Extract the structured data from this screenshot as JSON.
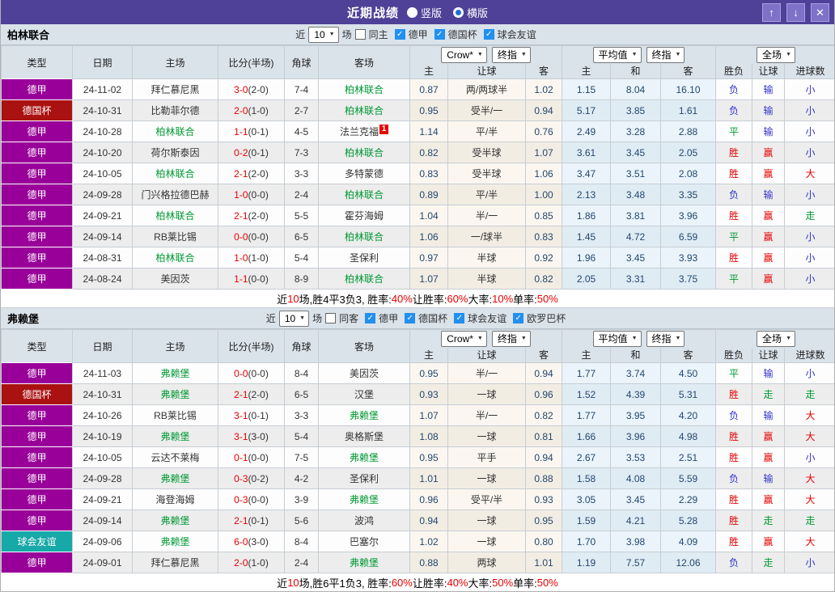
{
  "titlebar": {
    "title": "近期战绩",
    "radios": [
      {
        "label": "竖版",
        "selected": false
      },
      {
        "label": "横版",
        "selected": true
      }
    ],
    "buttons": {
      "up": "↑",
      "down": "↓",
      "close": "✕"
    }
  },
  "table_header": {
    "left_cols": [
      "类型",
      "日期",
      "主场",
      "比分(半场)",
      "角球",
      "客场"
    ],
    "dropdowns": {
      "crow": "Crow*",
      "final1": "终指",
      "avg": "平均值",
      "final2": "终指",
      "fulltime": "全场"
    },
    "sub_cols": [
      "主",
      "让球",
      "客",
      "主",
      "和",
      "客",
      "胜负",
      "让球",
      "进球数"
    ]
  },
  "type_colors": {
    "德甲": "#990099",
    "德国杯": "#aa1111",
    "球会友谊": "#17a8a8"
  },
  "result_colors": {
    "胜": "#e60000",
    "平": "#009933",
    "负": "#3333cc",
    "赢": "#e60000",
    "走": "#009933",
    "输": "#3333cc",
    "大": "#e60000",
    "小": "#3333cc"
  },
  "sections": [
    {
      "team": "柏林联合",
      "filter": {
        "near": "近",
        "count": "10",
        "games": "场",
        "same_checked": false,
        "same_label": "同主",
        "leagues": [
          {
            "label": "德甲",
            "checked": true
          },
          {
            "label": "德国杯",
            "checked": true
          },
          {
            "label": "球会友谊",
            "checked": true
          }
        ]
      },
      "rows": [
        {
          "type": "德甲",
          "date": "24-11-02",
          "home": "拜仁慕尼黑",
          "hs": false,
          "ft": "3-0",
          "half": "(2-0)",
          "corner": "7-4",
          "away": "柏林联合",
          "as": true,
          "badge": "",
          "ch": "0.87",
          "hc": "两/两球半",
          "ca": "1.02",
          "ah": "1.15",
          "ad": "8.04",
          "aa": "16.10",
          "r1": "负",
          "r2": "输",
          "r3": "小"
        },
        {
          "type": "德国杯",
          "date": "24-10-31",
          "home": "比勒菲尔德",
          "hs": false,
          "ft": "2-0",
          "half": "(1-0)",
          "corner": "2-7",
          "away": "柏林联合",
          "as": true,
          "badge": "",
          "ch": "0.95",
          "hc": "受半/一",
          "ca": "0.94",
          "ah": "5.17",
          "ad": "3.85",
          "aa": "1.61",
          "r1": "负",
          "r2": "输",
          "r3": "小"
        },
        {
          "type": "德甲",
          "date": "24-10-28",
          "home": "柏林联合",
          "hs": true,
          "ft": "1-1",
          "half": "(0-1)",
          "corner": "4-5",
          "away": "法兰克福",
          "as": false,
          "badge": "1",
          "ch": "1.14",
          "hc": "平/半",
          "ca": "0.76",
          "ah": "2.49",
          "ad": "3.28",
          "aa": "2.88",
          "r1": "平",
          "r2": "输",
          "r3": "小"
        },
        {
          "type": "德甲",
          "date": "24-10-20",
          "home": "荷尔斯泰因",
          "hs": false,
          "ft": "0-2",
          "half": "(0-1)",
          "corner": "7-3",
          "away": "柏林联合",
          "as": true,
          "badge": "",
          "ch": "0.82",
          "hc": "受半球",
          "ca": "1.07",
          "ah": "3.61",
          "ad": "3.45",
          "aa": "2.05",
          "r1": "胜",
          "r2": "赢",
          "r3": "小"
        },
        {
          "type": "德甲",
          "date": "24-10-05",
          "home": "柏林联合",
          "hs": true,
          "ft": "2-1",
          "half": "(2-0)",
          "corner": "3-3",
          "away": "多特蒙德",
          "as": false,
          "badge": "",
          "ch": "0.83",
          "hc": "受半球",
          "ca": "1.06",
          "ah": "3.47",
          "ad": "3.51",
          "aa": "2.08",
          "r1": "胜",
          "r2": "赢",
          "r3": "大"
        },
        {
          "type": "德甲",
          "date": "24-09-28",
          "home": "门兴格拉德巴赫",
          "hs": false,
          "ft": "1-0",
          "half": "(0-0)",
          "corner": "2-4",
          "away": "柏林联合",
          "as": true,
          "badge": "",
          "ch": "0.89",
          "hc": "平/半",
          "ca": "1.00",
          "ah": "2.13",
          "ad": "3.48",
          "aa": "3.35",
          "r1": "负",
          "r2": "输",
          "r3": "小"
        },
        {
          "type": "德甲",
          "date": "24-09-21",
          "home": "柏林联合",
          "hs": true,
          "ft": "2-1",
          "half": "(2-0)",
          "corner": "5-5",
          "away": "霍芬海姆",
          "as": false,
          "badge": "",
          "ch": "1.04",
          "hc": "半/一",
          "ca": "0.85",
          "ah": "1.86",
          "ad": "3.81",
          "aa": "3.96",
          "r1": "胜",
          "r2": "赢",
          "r3": "走"
        },
        {
          "type": "德甲",
          "date": "24-09-14",
          "home": "RB莱比锡",
          "hs": false,
          "ft": "0-0",
          "half": "(0-0)",
          "corner": "6-5",
          "away": "柏林联合",
          "as": true,
          "badge": "",
          "ch": "1.06",
          "hc": "一/球半",
          "ca": "0.83",
          "ah": "1.45",
          "ad": "4.72",
          "aa": "6.59",
          "r1": "平",
          "r2": "赢",
          "r3": "小"
        },
        {
          "type": "德甲",
          "date": "24-08-31",
          "home": "柏林联合",
          "hs": true,
          "ft": "1-0",
          "half": "(1-0)",
          "corner": "5-4",
          "away": "圣保利",
          "as": false,
          "badge": "",
          "ch": "0.97",
          "hc": "半球",
          "ca": "0.92",
          "ah": "1.96",
          "ad": "3.45",
          "aa": "3.93",
          "r1": "胜",
          "r2": "赢",
          "r3": "小"
        },
        {
          "type": "德甲",
          "date": "24-08-24",
          "home": "美因茨",
          "hs": false,
          "ft": "1-1",
          "half": "(0-0)",
          "corner": "8-9",
          "away": "柏林联合",
          "as": true,
          "badge": "",
          "ch": "1.07",
          "hc": "半球",
          "ca": "0.82",
          "ah": "2.05",
          "ad": "3.31",
          "aa": "3.75",
          "r1": "平",
          "r2": "赢",
          "r3": "小"
        }
      ],
      "summary": [
        [
          "近",
          "b"
        ],
        [
          "10",
          "r"
        ],
        [
          "场,胜4平3负3, 胜率:",
          "b"
        ],
        [
          "40%",
          "r"
        ],
        [
          " 让胜率:",
          "b"
        ],
        [
          "60%",
          "r"
        ],
        [
          " 大率:",
          "b"
        ],
        [
          "10%",
          "r"
        ],
        [
          " 单率:",
          "b"
        ],
        [
          "50%",
          "r"
        ]
      ]
    },
    {
      "team": "弗赖堡",
      "filter": {
        "near": "近",
        "count": "10",
        "games": "场",
        "same_checked": false,
        "same_label": "同客",
        "leagues": [
          {
            "label": "德甲",
            "checked": true
          },
          {
            "label": "德国杯",
            "checked": true
          },
          {
            "label": "球会友谊",
            "checked": true
          },
          {
            "label": "欧罗巴杯",
            "checked": true
          }
        ]
      },
      "rows": [
        {
          "type": "德甲",
          "date": "24-11-03",
          "home": "弗赖堡",
          "hs": true,
          "ft": "0-0",
          "half": "(0-0)",
          "corner": "8-4",
          "away": "美因茨",
          "as": false,
          "badge": "",
          "ch": "0.95",
          "hc": "半/一",
          "ca": "0.94",
          "ah": "1.77",
          "ad": "3.74",
          "aa": "4.50",
          "r1": "平",
          "r2": "输",
          "r3": "小"
        },
        {
          "type": "德国杯",
          "date": "24-10-31",
          "home": "弗赖堡",
          "hs": true,
          "ft": "2-1",
          "half": "(2-0)",
          "corner": "6-5",
          "away": "汉堡",
          "as": false,
          "badge": "",
          "ch": "0.93",
          "hc": "一球",
          "ca": "0.96",
          "ah": "1.52",
          "ad": "4.39",
          "aa": "5.31",
          "r1": "胜",
          "r2": "走",
          "r3": "走"
        },
        {
          "type": "德甲",
          "date": "24-10-26",
          "home": "RB莱比锡",
          "hs": false,
          "ft": "3-1",
          "half": "(0-1)",
          "corner": "3-3",
          "away": "弗赖堡",
          "as": true,
          "badge": "",
          "ch": "1.07",
          "hc": "半/一",
          "ca": "0.82",
          "ah": "1.77",
          "ad": "3.95",
          "aa": "4.20",
          "r1": "负",
          "r2": "输",
          "r3": "大"
        },
        {
          "type": "德甲",
          "date": "24-10-19",
          "home": "弗赖堡",
          "hs": true,
          "ft": "3-1",
          "half": "(3-0)",
          "corner": "5-4",
          "away": "奥格斯堡",
          "as": false,
          "badge": "",
          "ch": "1.08",
          "hc": "一球",
          "ca": "0.81",
          "ah": "1.66",
          "ad": "3.96",
          "aa": "4.98",
          "r1": "胜",
          "r2": "赢",
          "r3": "大"
        },
        {
          "type": "德甲",
          "date": "24-10-05",
          "home": "云达不莱梅",
          "hs": false,
          "ft": "0-1",
          "half": "(0-0)",
          "corner": "7-5",
          "away": "弗赖堡",
          "as": true,
          "badge": "",
          "ch": "0.95",
          "hc": "平手",
          "ca": "0.94",
          "ah": "2.67",
          "ad": "3.53",
          "aa": "2.51",
          "r1": "胜",
          "r2": "赢",
          "r3": "小"
        },
        {
          "type": "德甲",
          "date": "24-09-28",
          "home": "弗赖堡",
          "hs": true,
          "ft": "0-3",
          "half": "(0-2)",
          "corner": "4-2",
          "away": "圣保利",
          "as": false,
          "badge": "",
          "ch": "1.01",
          "hc": "一球",
          "ca": "0.88",
          "ah": "1.58",
          "ad": "4.08",
          "aa": "5.59",
          "r1": "负",
          "r2": "输",
          "r3": "大"
        },
        {
          "type": "德甲",
          "date": "24-09-21",
          "home": "海登海姆",
          "hs": false,
          "ft": "0-3",
          "half": "(0-0)",
          "corner": "3-9",
          "away": "弗赖堡",
          "as": true,
          "badge": "",
          "ch": "0.96",
          "hc": "受平/半",
          "ca": "0.93",
          "ah": "3.05",
          "ad": "3.45",
          "aa": "2.29",
          "r1": "胜",
          "r2": "赢",
          "r3": "大"
        },
        {
          "type": "德甲",
          "date": "24-09-14",
          "home": "弗赖堡",
          "hs": true,
          "ft": "2-1",
          "half": "(0-1)",
          "corner": "5-6",
          "away": "波鸿",
          "as": false,
          "badge": "",
          "ch": "0.94",
          "hc": "一球",
          "ca": "0.95",
          "ah": "1.59",
          "ad": "4.21",
          "aa": "5.28",
          "r1": "胜",
          "r2": "走",
          "r3": "走"
        },
        {
          "type": "球会友谊",
          "date": "24-09-06",
          "home": "弗赖堡",
          "hs": true,
          "ft": "6-0",
          "half": "(3-0)",
          "corner": "8-4",
          "away": "巴塞尔",
          "as": false,
          "badge": "",
          "ch": "1.02",
          "hc": "一球",
          "ca": "0.80",
          "ah": "1.70",
          "ad": "3.98",
          "aa": "4.09",
          "r1": "胜",
          "r2": "赢",
          "r3": "大"
        },
        {
          "type": "德甲",
          "date": "24-09-01",
          "home": "拜仁慕尼黑",
          "hs": false,
          "ft": "2-0",
          "half": "(1-0)",
          "corner": "2-4",
          "away": "弗赖堡",
          "as": true,
          "badge": "",
          "ch": "0.88",
          "hc": "两球",
          "ca": "1.01",
          "ah": "1.19",
          "ad": "7.57",
          "aa": "12.06",
          "r1": "负",
          "r2": "走",
          "r3": "小"
        }
      ],
      "summary": [
        [
          "近",
          "b"
        ],
        [
          "10",
          "r"
        ],
        [
          "场,胜6平1负3, 胜率:",
          "b"
        ],
        [
          "60%",
          "r"
        ],
        [
          " 让胜率:",
          "b"
        ],
        [
          "40%",
          "r"
        ],
        [
          " 大率:",
          "b"
        ],
        [
          "50%",
          "r"
        ],
        [
          " 单率:",
          "b"
        ],
        [
          "50%",
          "r"
        ]
      ]
    }
  ]
}
